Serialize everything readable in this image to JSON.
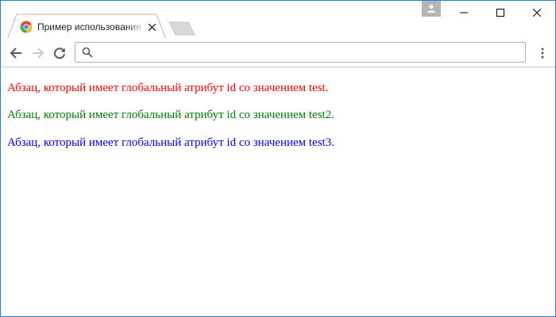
{
  "tab": {
    "title": "Пример использования",
    "favicon": "chrome-favicon-icon"
  },
  "toolbar": {
    "address_value": ""
  },
  "content": {
    "paragraphs": [
      {
        "id": "test",
        "text": "Абзац, который имеет глобальный атрибут id со значением test.",
        "color": "#ff0000"
      },
      {
        "id": "test2",
        "text": "Абзац, который имеет глобальный атрибут id со значением test2.",
        "color": "#008000"
      },
      {
        "id": "test3",
        "text": "Абзац, который имеет глобальный атрибут id со значением test3.",
        "color": "#0000ff"
      }
    ]
  },
  "colors": {
    "window_border": "#1883d7",
    "tab_bg": "#ffffff",
    "newtab_bg": "#d8d8d8"
  }
}
